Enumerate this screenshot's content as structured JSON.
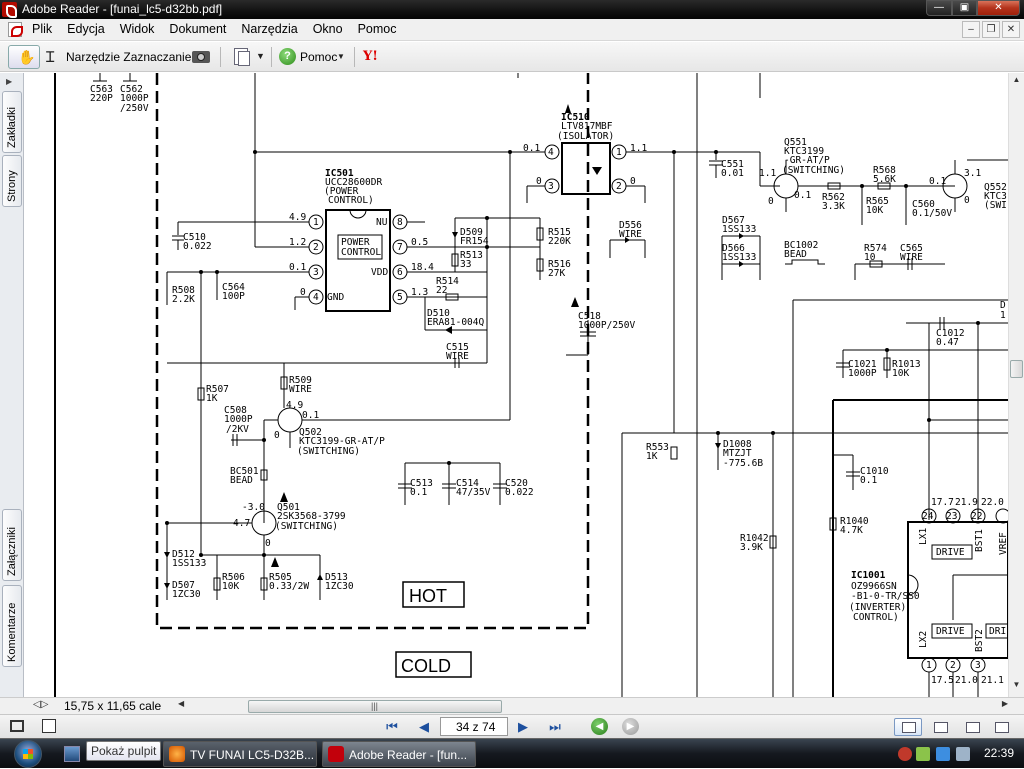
{
  "window": {
    "title": "Adobe Reader - [funai_lc5-d32bb.pdf]",
    "min_glyph": "—",
    "max_glyph": "▣",
    "close_glyph": "✕"
  },
  "menubar": {
    "items": [
      "Plik",
      "Edycja",
      "Widok",
      "Dokument",
      "Narzędzia",
      "Okno",
      "Pomoc"
    ],
    "mdi": [
      "–",
      "❐",
      "✕"
    ]
  },
  "toolbar": {
    "hand_glyph": "✋",
    "select_label": "Narzędzie Zaznaczanie",
    "help_label": "Pomoc",
    "dropdown_glyph": "▼",
    "y_label": "Y!"
  },
  "sidebar": {
    "tabs": [
      "Zakładki",
      "Strony",
      "Załączniki",
      "Komentarze"
    ],
    "expand_glyph": "▶"
  },
  "schematic": {
    "labels": {
      "c563": "C563",
      "c563v": "220P",
      "c562": "C562",
      "c562v": "1000P",
      "c562r": "/250V",
      "ic510": "IC510",
      "ic510v": "LTV817MBF",
      "ic510d": "(ISOLATOR)",
      "ic501": "IC501",
      "ic501v": "UCC28600DR",
      "ic501d1": "(POWER",
      "ic501d2": "CONTROL)",
      "pc1": "POWER",
      "pc2": "CONTROL",
      "nu": "NU",
      "vdd": "VDD",
      "gnd": "GND",
      "v49a": "4.9",
      "v12": "1.2",
      "v01a": "0.1",
      "v0a": "0",
      "v05": "0.5",
      "v184": "18.4",
      "v13a": "1.3",
      "c510": "C510",
      "c510v": "0.022",
      "r508": "R508",
      "r508v": "2.2K",
      "c564": "C564",
      "c564v": "100P",
      "d509": "D509",
      "d509v": "FR154",
      "r515": "R515",
      "r515v": "220K",
      "r513": "R513",
      "r513v": "33",
      "r516": "R516",
      "r516v": "27K",
      "r514": "R514",
      "r514v": "22",
      "d510": "D510",
      "d510v": "ERA81-004Q",
      "c515": "C515",
      "c515v": "WIRE",
      "c518": "C518",
      "c518v": "1000P/250V",
      "d556": "D556",
      "d556v": "WIRE",
      "q551": "Q551",
      "q551v": "KTC3199",
      "q551d": "-GR-AT/P",
      "q551s": "(SWITCHING)",
      "c551": "C551",
      "c551v": "0.01",
      "v11a": "1.1",
      "v11b": "1.1",
      "v01b": "0.1",
      "v0b": "0",
      "v01c": "0.1",
      "v31": "3.1",
      "v0c": "0",
      "v04": "0.1",
      "v0d": "0",
      "v0e": "0",
      "r568": "R568",
      "r568v": "5.6K",
      "r562": "R562",
      "r562v": "3.3K",
      "r565": "R565",
      "r565v": "10K",
      "c560": "C560",
      "c560v": "0.1/50V",
      "q552": "Q552",
      "q552v": "KTC3",
      "q552s": "(SWI",
      "d567": "D567",
      "d567v": "1SS133",
      "d566": "D566",
      "d566v": "1SS133",
      "bc1002": "BC1002",
      "bc1002v": "BEAD",
      "r574": "R574",
      "r574v": "10",
      "c565": "C565",
      "c565v": "WIRE",
      "c1012": "C1012",
      "c1012v": "0.47",
      "c1021": "C1021",
      "c1021v": "1000P",
      "r1013": "R1013",
      "r1013v": "10K",
      "r507": "R507",
      "r507v": "1K",
      "r509": "R509",
      "r509v": "WIRE",
      "c508": "C508",
      "c508v": "1000P",
      "c508r": "/2KV",
      "q502": "Q502",
      "q502v": "KTC3199-GR-AT/P",
      "q502s": "(SWITCHING)",
      "v49b": "4.9",
      "v01d": "0.1",
      "v0f": "0",
      "bc501": "BC501",
      "bc501v": "BEAD",
      "q501": "Q501",
      "q501v": "2SK3568-3799",
      "q501s": "(SWITCHING)",
      "vm30": "-3.0",
      "v47": "4.7",
      "v0g": "0",
      "c513": "C513",
      "c513v": "0.1",
      "c514": "C514",
      "c514v": "47/35V",
      "c520": "C520",
      "c520v": "0.022",
      "d512": "D512",
      "d512v": "1SS133",
      "d507": "D507",
      "d507v": "1ZC30",
      "r506": "R506",
      "r506v": "10K",
      "r505": "R505",
      "r505v": "0.33/2W",
      "d513": "D513",
      "d513v": "1ZC30",
      "hot": "HOT",
      "cold": "COLD",
      "r553": "R553",
      "r553v": "1K",
      "d1008": "D1008",
      "d1008v": "MTZJT",
      "d1008r": "-775.6B",
      "c1010": "C1010",
      "c1010v": "0.1",
      "r1040": "R1040",
      "r1040v": "4.7K",
      "r1042": "R1042",
      "r1042v": "3.9K",
      "ic1001": "IC1001",
      "ic1001v": "OZ9966SN",
      "ic1001d": "-B1-0-TR/SS0",
      "ic1001d1": "(INVERTER)",
      "ic1001d2": "CONTROL)",
      "drive1": "DRIVE",
      "drive2": "DRIVE",
      "dri3": "DRI",
      "lx1": "LX1",
      "bst1": "BST1",
      "vref": "VREF",
      "lx2": "LX2",
      "bst2": "BST2",
      "p177": "17.7",
      "p219": "21.9",
      "p220": "22.0",
      "p175": "17.5",
      "p210": "21.0",
      "p211": "21.1",
      "pin24": "24",
      "pin23": "23",
      "pin22": "22",
      "pin1b": "1",
      "pin2b": "2",
      "pin3b": "3",
      "pin1": "1",
      "pin2": "2",
      "pin3": "3",
      "pin4": "4",
      "pin5": "5",
      "pin6": "6",
      "pin7": "7",
      "pin8": "8",
      "oc1": "1",
      "oc2": "2",
      "oc3": "3",
      "oc4": "4",
      "d_trunc": "D",
      "one_trunc": "1"
    }
  },
  "status": {
    "page_size": "15,75 x 11,65 cale",
    "scroll_left": "◀",
    "scroll_right": "▶",
    "grip": "|||"
  },
  "navigation": {
    "page_display": "34 z 74",
    "first": "⏮",
    "prev": "◀",
    "next": "▶",
    "last": "⏭",
    "back": "◀",
    "forward": "▶"
  },
  "taskbar": {
    "tooltip": "Pokaż pulpit",
    "tasks": [
      "TV FUNAI LC5-D32B...",
      "Adobe Reader - [fun..."
    ],
    "clock": "22:39"
  }
}
